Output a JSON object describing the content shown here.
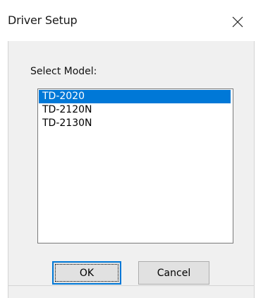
{
  "window": {
    "title": "Driver Setup"
  },
  "icons": {
    "close": "close-icon"
  },
  "form": {
    "select_label": "Select Model:",
    "models": [
      "TD-2020",
      "TD-2120N",
      "TD-2130N"
    ],
    "selected_model": "TD-2020"
  },
  "buttons": {
    "ok_label": "OK",
    "cancel_label": "Cancel"
  },
  "colors": {
    "selection": "#0078d7",
    "dialog_background": "#f0f0f0"
  }
}
